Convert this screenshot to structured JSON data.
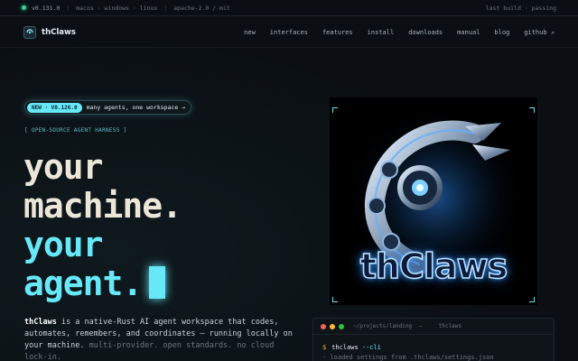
{
  "statusbar": {
    "version": "v0.131.0",
    "platforms": "macos · windows · linux",
    "license": "apache-2.0 / mit",
    "build": "last build · passing"
  },
  "nav": {
    "brand": "thClaws",
    "links": [
      "new",
      "interfaces",
      "features",
      "install",
      "downloads",
      "manual",
      "blog",
      "github ↗"
    ]
  },
  "hero_badge": {
    "label": "NEW · V0.126.0",
    "text": "many agents, one workspace →"
  },
  "tagline": "[ OPEN-SOURCE AGENT HARNESS ]",
  "headline": {
    "line1": "your",
    "line2": "machine.",
    "line3": "your",
    "line4": "agent."
  },
  "description": {
    "brand": "thClaws",
    "body": " is a native-Rust AI agent workspace that codes, automates, remembers, and coordinates — running locally on your machine. ",
    "muted": "multi-provider. open standards. no cloud lock-in."
  },
  "hero_image": {
    "wordmark": "thClaws"
  },
  "terminal": {
    "path": "~/projects/landing",
    "separator": "—",
    "app": "thclaws",
    "prompt": "$",
    "command": "thclaws",
    "flag": "--cli",
    "output": "· loaded settings from .thclaws/settings.json"
  },
  "colors": {
    "accent": "#67e8f9",
    "status_ok": "#34d399",
    "headline_light": "#ece6d8"
  }
}
